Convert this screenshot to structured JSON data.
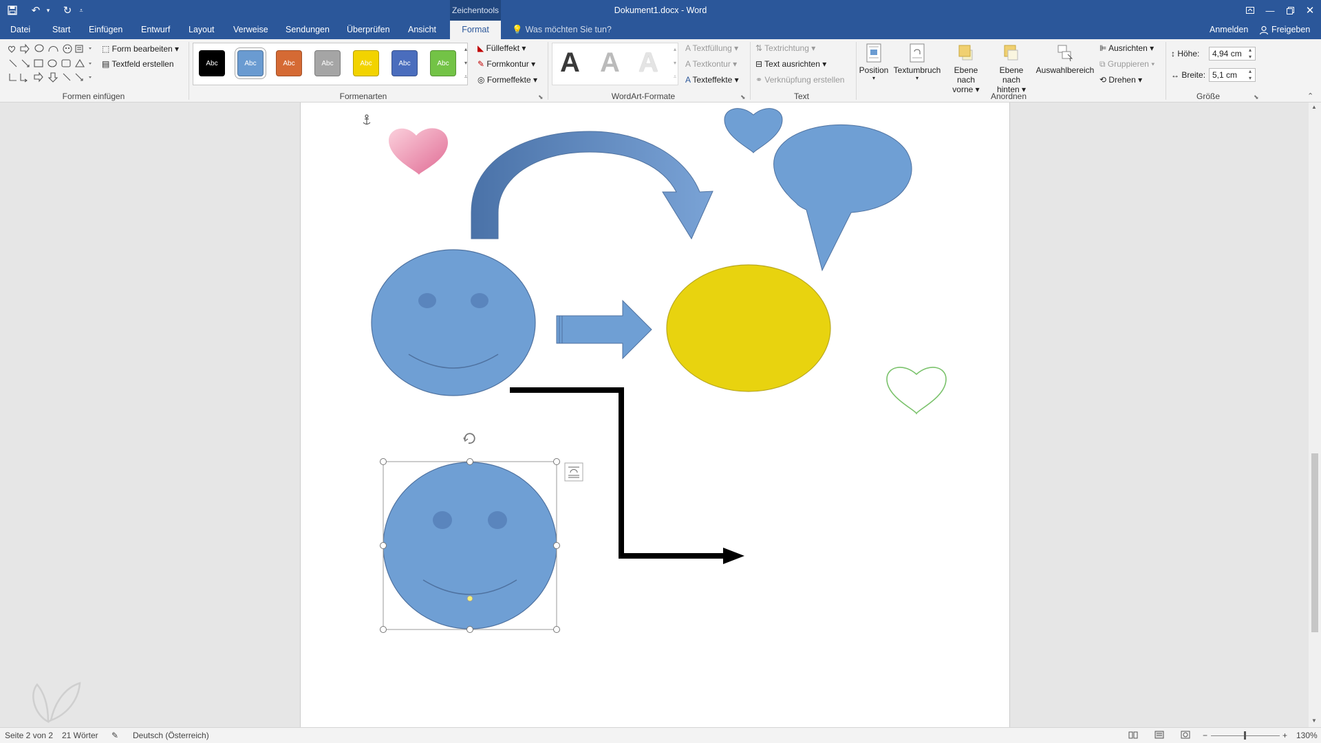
{
  "titlebar": {
    "document_title": "Dokument1.docx - Word",
    "contextual_tab_label": "Zeichentools"
  },
  "tabs": [
    {
      "label": "Datei"
    },
    {
      "label": "Start"
    },
    {
      "label": "Einfügen"
    },
    {
      "label": "Entwurf"
    },
    {
      "label": "Layout"
    },
    {
      "label": "Verweise"
    },
    {
      "label": "Sendungen"
    },
    {
      "label": "Überprüfen"
    },
    {
      "label": "Ansicht"
    },
    {
      "label": "Format"
    }
  ],
  "tell_me": "Was möchten Sie tun?",
  "account": {
    "signin": "Anmelden",
    "share": "Freigeben"
  },
  "ribbon": {
    "formen_einfuegen": {
      "label": "Formen einfügen",
      "edit_shape": "Form bearbeiten",
      "draw_textbox": "Textfeld erstellen"
    },
    "formenarten": {
      "label": "Formenarten",
      "style_text": "Abc",
      "fill": "Fülleffekt",
      "outline": "Formkontur",
      "effects": "Formeffekte",
      "swatches": [
        "#000000",
        "#6a9bd1",
        "#d56a34",
        "#a5a5a5",
        "#f2d300",
        "#4a6dbd",
        "#73c346"
      ]
    },
    "wordart": {
      "label": "WordArt-Formate",
      "letter": "A",
      "text_fill": "Textfüllung",
      "text_outline": "Textkontur",
      "text_effects": "Texteffekte"
    },
    "text": {
      "label": "Text",
      "direction": "Textrichtung",
      "align": "Text ausrichten",
      "link": "Verknüpfung erstellen"
    },
    "anordnen": {
      "label": "Anordnen",
      "position": "Position",
      "wrap": "Textumbruch",
      "forward_1": "Ebene nach",
      "forward_2": "vorne",
      "backward_1": "Ebene nach",
      "backward_2": "hinten",
      "selection_pane": "Auswahlbereich",
      "align": "Ausrichten",
      "group": "Gruppieren",
      "rotate": "Drehen"
    },
    "groesse": {
      "label": "Größe",
      "height_label": "Höhe:",
      "height_value": "4,94 cm",
      "width_label": "Breite:",
      "width_value": "5,1 cm"
    }
  },
  "status": {
    "page": "Seite 2 von 2",
    "words": "21 Wörter",
    "language": "Deutsch (Österreich)",
    "zoom": "130%"
  },
  "colors": {
    "word_blue": "#2b579a",
    "shape_blue": "#6f9fd4",
    "shape_yellow": "#e8d30f",
    "connector": "#000000"
  }
}
